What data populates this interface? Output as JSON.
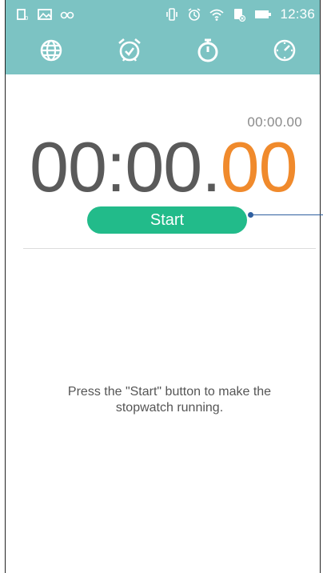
{
  "status_bar": {
    "time": "12:36",
    "icons": [
      "sim-icon",
      "image-icon",
      "glasses-icon",
      "vibrate-icon",
      "alarm-icon",
      "wifi-icon",
      "data-icon",
      "battery-icon"
    ]
  },
  "tabs": [
    {
      "name": "world-clock",
      "icon": "globe-icon"
    },
    {
      "name": "alarm",
      "icon": "alarm-clock-icon"
    },
    {
      "name": "stopwatch",
      "icon": "stopwatch-icon",
      "active": true
    },
    {
      "name": "timer",
      "icon": "timer-icon"
    }
  ],
  "stopwatch": {
    "lap_time": "00:00.00",
    "main_time_main": "00:00.",
    "main_time_hundredths": "00",
    "start_label": "Start",
    "hint": "Press the \"Start\" button to make the stopwatch running."
  },
  "colors": {
    "header": "#7cc3c3",
    "accent_orange": "#f08a2c",
    "button_green": "#22bb8a",
    "callout_blue": "#2f5fa0"
  }
}
